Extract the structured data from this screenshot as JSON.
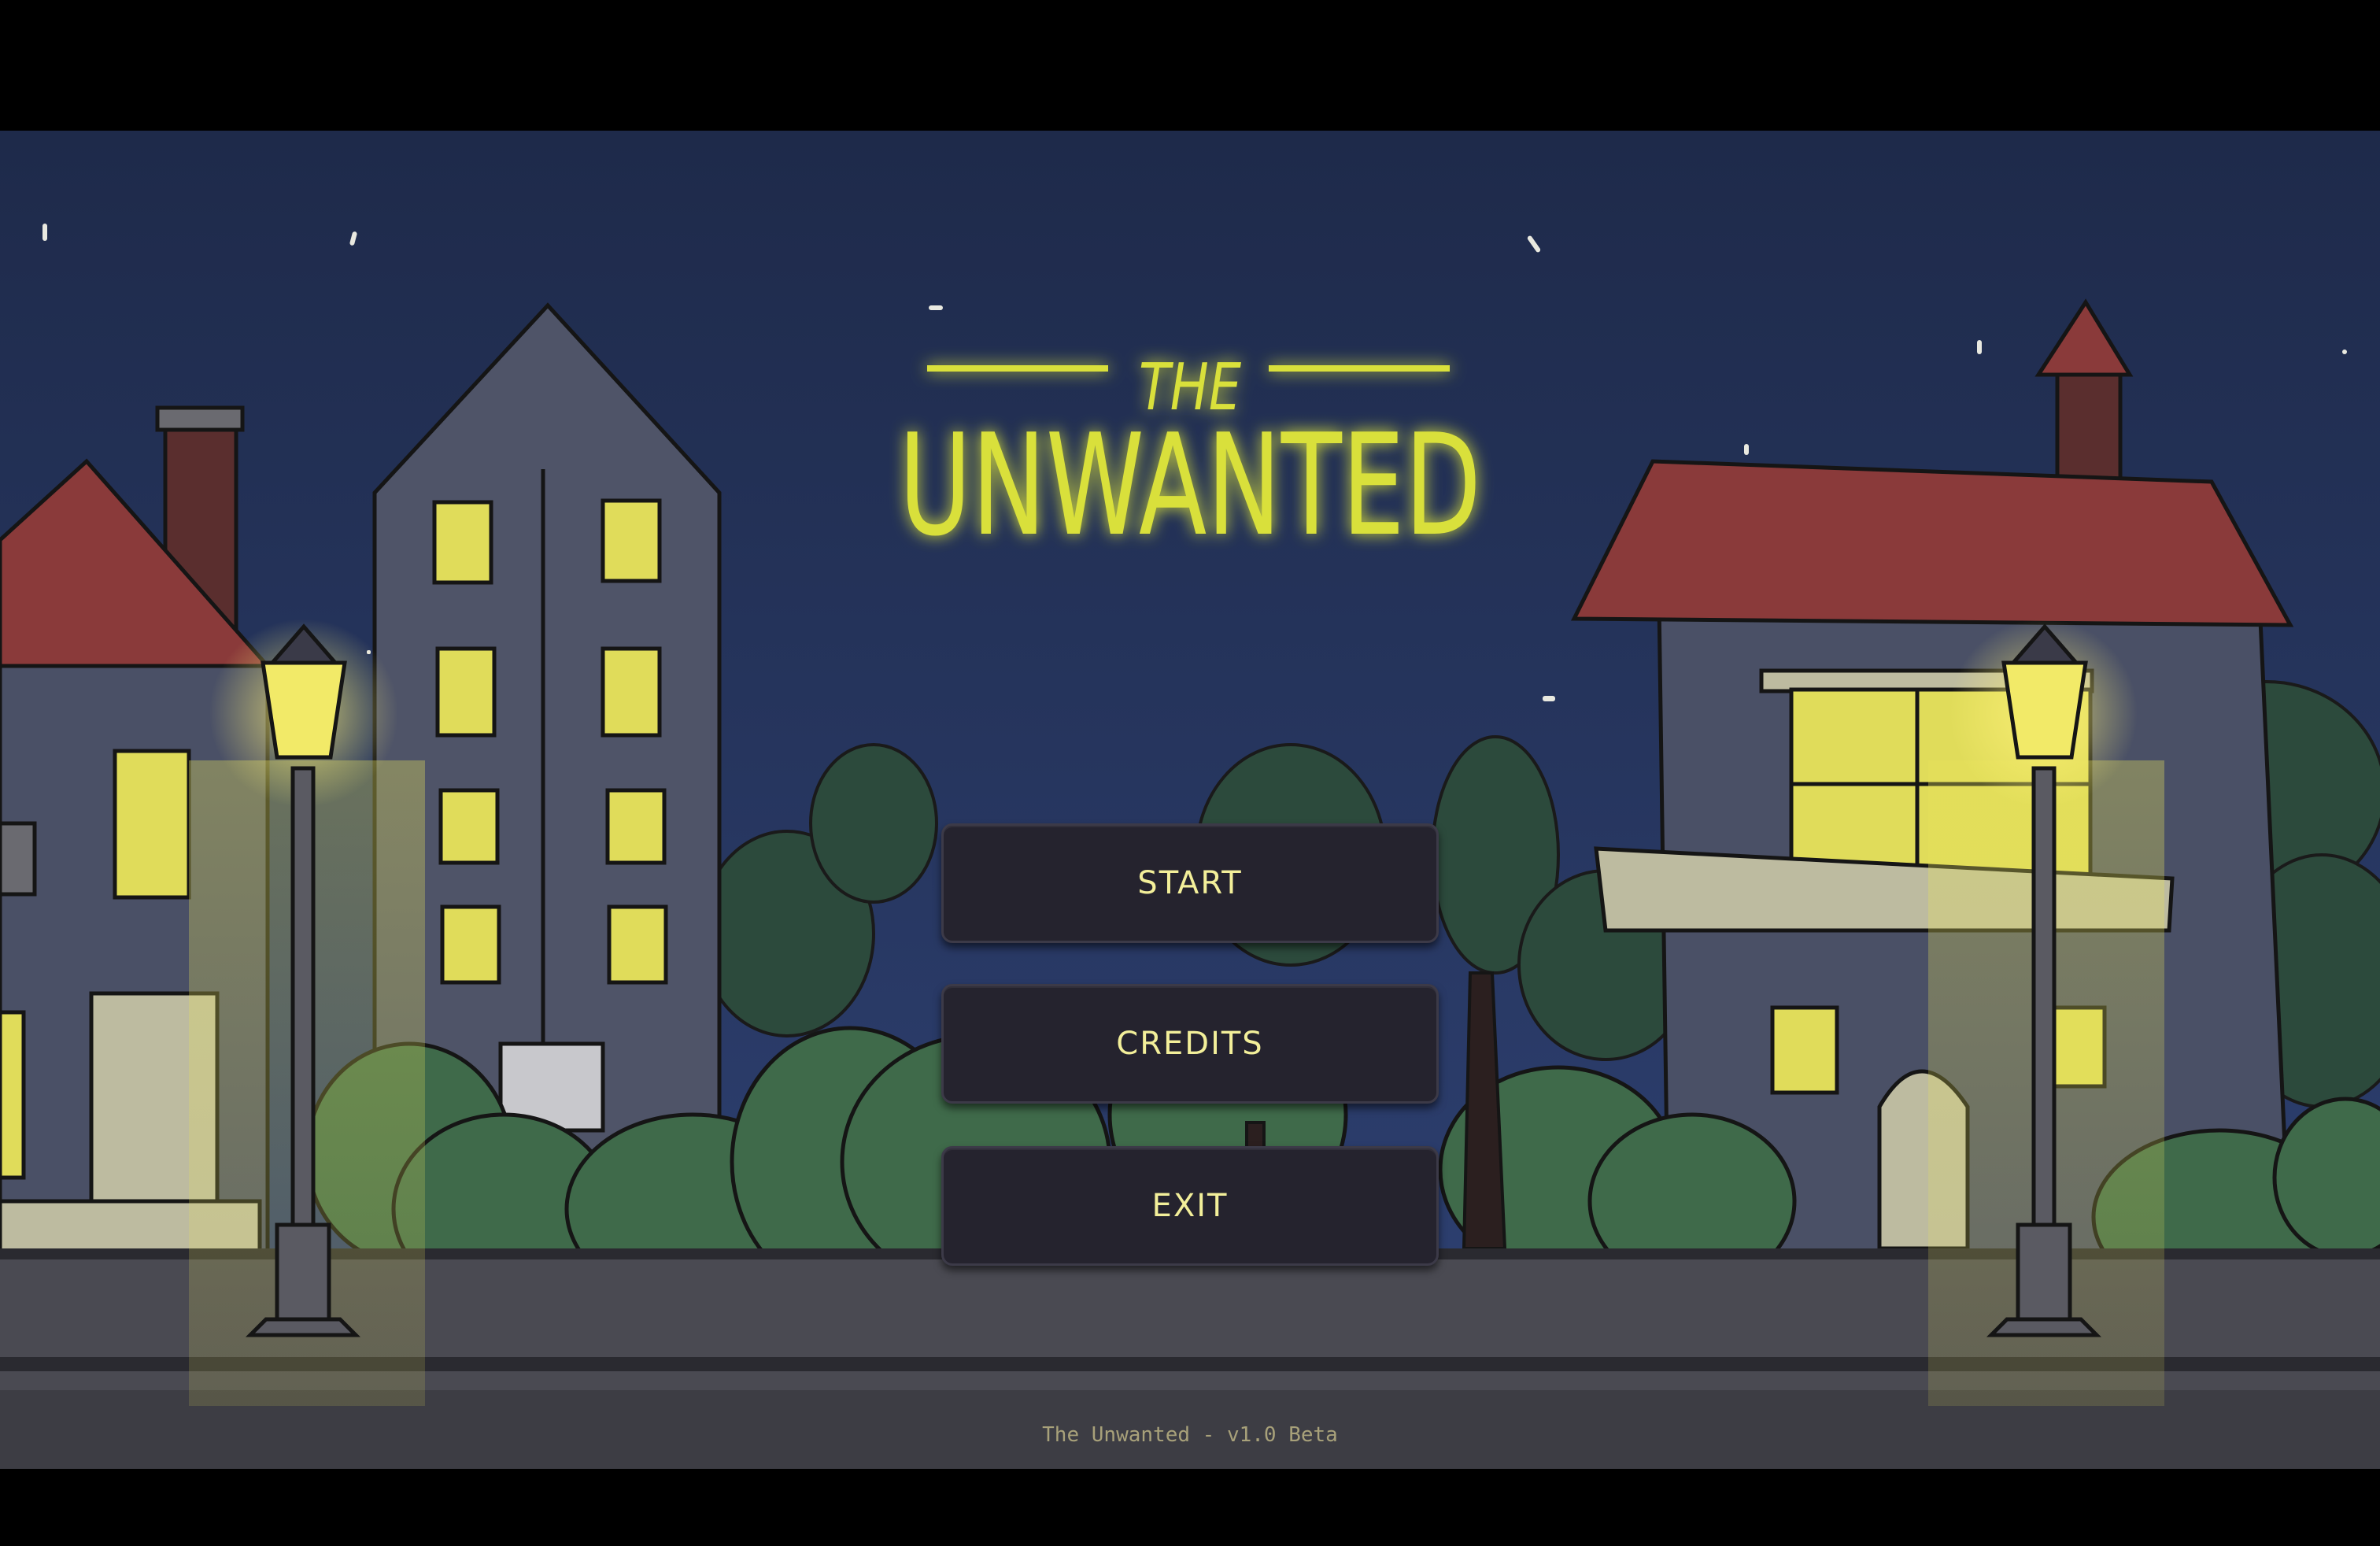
{
  "game": {
    "title_top": "THE",
    "title_main": "UNWANTED"
  },
  "menu": {
    "start_label": "START",
    "credits_label": "CREDITS",
    "exit_label": "EXIT"
  },
  "footer": {
    "version": "The Unwanted - v1.0 Beta"
  },
  "colors": {
    "sky_top": "#1e2a4a",
    "sky_bottom": "#2e3f70",
    "title_yellow": "#d9e03a",
    "window_yellow": "#e0dc5a",
    "roof_red": "#8a3a3a",
    "button_bg": "#25232e",
    "button_text": "#f3ef9a",
    "bush_green": "#3f6a4a",
    "street_gray": "#4a4a52"
  }
}
